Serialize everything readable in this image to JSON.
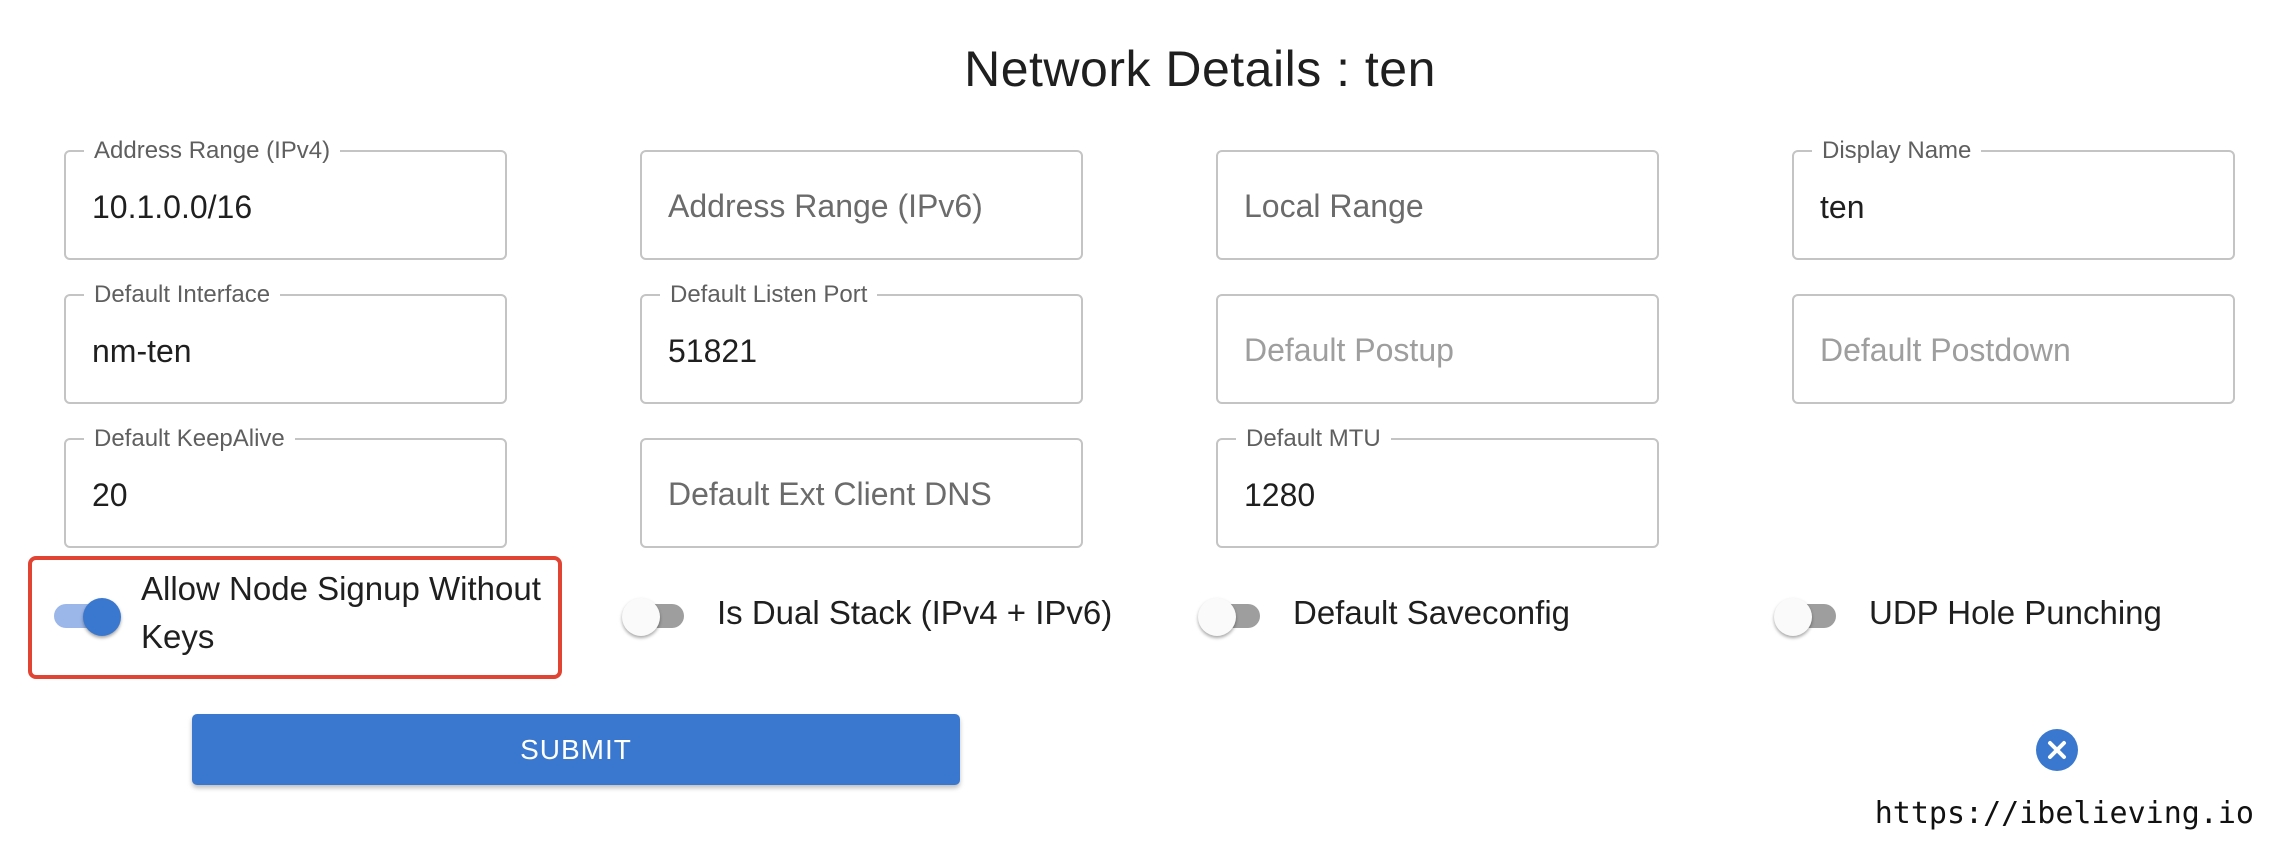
{
  "page_title": "Network Details : ten",
  "fields": {
    "address_range_ipv4": {
      "label": "Address Range (IPv4)",
      "value": "10.1.0.0/16"
    },
    "address_range_ipv6": {
      "placeholder": "Address Range (IPv6)"
    },
    "local_range": {
      "placeholder": "Local Range"
    },
    "display_name": {
      "label": "Display Name",
      "value": "ten"
    },
    "default_interface": {
      "label": "Default Interface",
      "value": "nm-ten"
    },
    "default_listen_port": {
      "label": "Default Listen Port",
      "value": "51821"
    },
    "default_postup": {
      "placeholder": "Default Postup"
    },
    "default_postdown": {
      "placeholder": "Default Postdown"
    },
    "default_keepalive": {
      "label": "Default KeepAlive",
      "value": "20"
    },
    "default_ext_client_dns": {
      "placeholder": "Default Ext Client DNS"
    },
    "default_mtu": {
      "label": "Default MTU",
      "value": "1280"
    }
  },
  "toggles": {
    "allow_node_signup": {
      "label_line1": "Allow Node Signup Without",
      "label_line2": "Keys",
      "checked": true
    },
    "is_dual_stack": {
      "label": "Is Dual Stack (IPv4 + IPv6)",
      "checked": false
    },
    "default_saveconfig": {
      "label": "Default Saveconfig",
      "checked": false
    },
    "udp_hole_punching": {
      "label": "UDP Hole Punching",
      "checked": false
    }
  },
  "actions": {
    "submit_label": "SUBMIT",
    "close_icon": "close-circle-icon"
  },
  "watermark": "https://ibelieving.io",
  "colors": {
    "accent": "#3a78cf",
    "highlight": "#e14433",
    "toggle_off": "#9e9e9e",
    "border": "#c4c4c4"
  }
}
